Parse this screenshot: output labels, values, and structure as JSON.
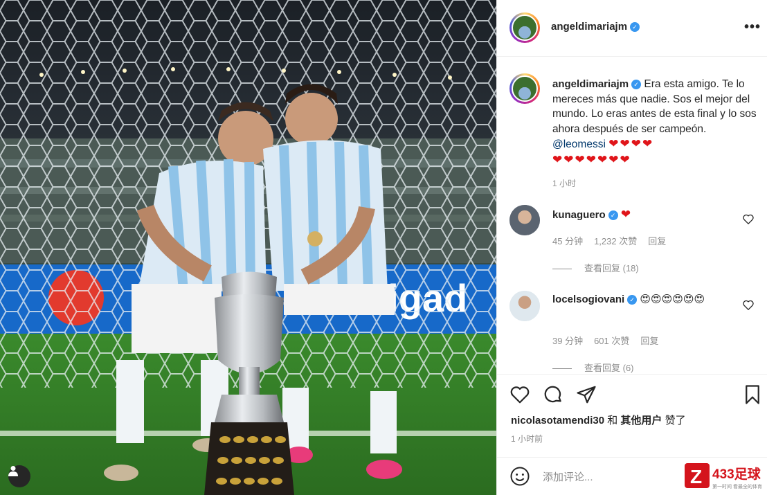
{
  "post": {
    "author": "angeldimariajm",
    "caption": "Era esta amigo. Te lo mereces más que nadie. Sos el mejor del mundo. Lo eras antes de esta final y lo sos ahora después de ser campeón.",
    "mention": "@leomessi",
    "hearts_line1": "❤❤❤❤",
    "hearts_line2": "❤❤❤❤❤❤❤",
    "caption_time": "1 小时",
    "more_label": "•••"
  },
  "comments": [
    {
      "user": "kunaguero",
      "text": "❤",
      "time": "45 分钟",
      "likes": "1,232 次赞",
      "reply": "回复",
      "view_replies": "查看回复 (18)"
    },
    {
      "user": "locelsogiovani",
      "text": "😍😍😍😍😍😍",
      "time": "39 分钟",
      "likes": "601 次赞",
      "reply": "回复",
      "view_replies": "查看回复 (6)"
    }
  ],
  "likes_bar": {
    "first_liker": "nicolasotamendi30",
    "and": " 和 ",
    "others": "其他用户",
    "suffix": " 赞了",
    "time": "1 小时前"
  },
  "add_comment": {
    "placeholder": "添加评论..."
  },
  "watermark": {
    "logo_letter": "Z",
    "brand": "433足球",
    "sub": "第一时间 看最全的体育"
  },
  "icons": {
    "like": "heart-icon",
    "comment": "comment-icon",
    "share": "paper-plane-icon",
    "save": "bookmark-icon",
    "emoji": "smiley-icon",
    "tag": "user-tag-icon"
  },
  "colors": {
    "accent_link": "#00376b",
    "verified": "#3897f0",
    "heart": "#e0151a",
    "muted": "#8e8e8e"
  }
}
